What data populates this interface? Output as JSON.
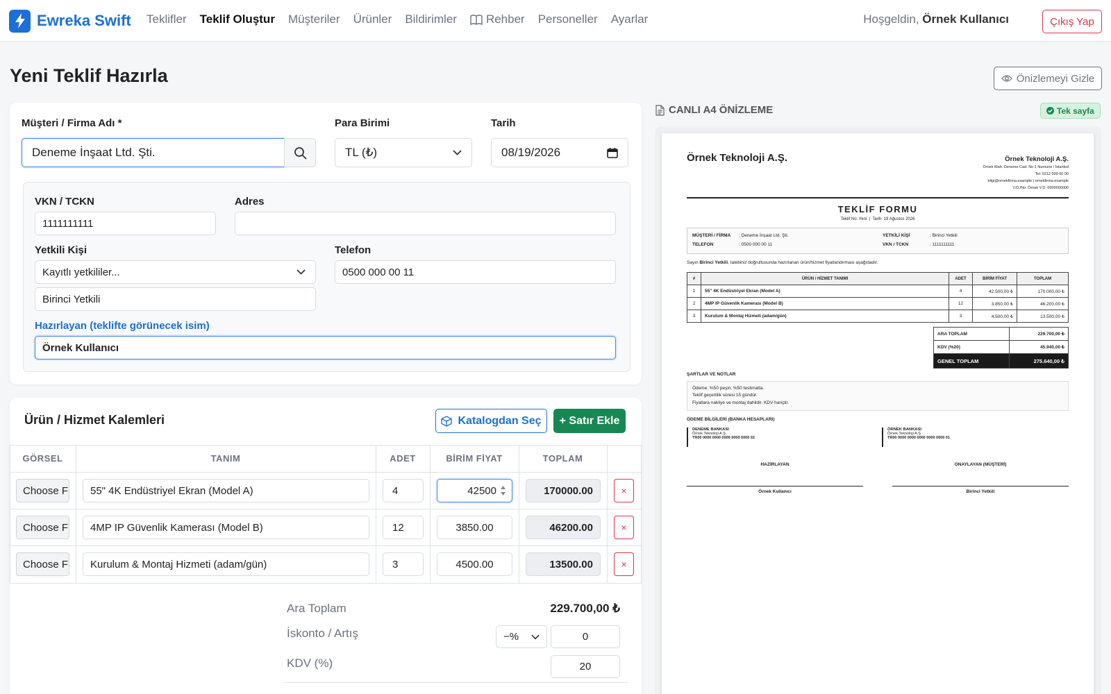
{
  "nav": {
    "brand": "Ewreka Swift",
    "links": [
      "Teklifler",
      "Teklif Oluştur",
      "Müşteriler",
      "Ürünler",
      "Bildirimler",
      "Rehber",
      "Personeller",
      "Ayarlar"
    ],
    "welcome_prefix": "Hoşgeldin,",
    "user": "Örnek Kullanıcı",
    "logout": "Çıkış Yap"
  },
  "page": {
    "title": "Yeni Teklif Hazırla",
    "hide_preview": "Önizlemeyi Gizle"
  },
  "form": {
    "customer_label": "Müşteri / Firma Adı *",
    "customer_value": "Deneme İnşaat Ltd. Şti.",
    "currency_label": "Para Birimi",
    "currency_value": "TL (₺)",
    "date_label": "Tarih",
    "date_value": "08/19/2026",
    "vkn_label": "VKN / TCKN",
    "vkn_value": "1111111111",
    "address_label": "Adres",
    "address_value": "",
    "contact_label": "Yetkili Kişi",
    "contact_select": "Kayıtlı yetkililer...",
    "contact_value": "Birinci Yetkili",
    "phone_label": "Telefon",
    "phone_value": "0500 000 00 11",
    "preparer_label": "Hazırlayan (teklifte görünecek isim)",
    "preparer_value": "Örnek Kullanıcı"
  },
  "items": {
    "title": "Ürün / Hizmet Kalemleri",
    "catalog_button": "Katalogdan Seç",
    "add_row_button": "+ Satır Ekle",
    "headers": [
      "GÖRSEL",
      "TANIM",
      "ADET",
      "BİRİM FİYAT",
      "TOPLAM"
    ],
    "choose_file": "Choose File",
    "rows": [
      {
        "desc": "55\" 4K Endüstriyel Ekran (Model A)",
        "qty": "4",
        "price": "42500",
        "total": "170000.00"
      },
      {
        "desc": "4MP IP Güvenlik Kamerası (Model B)",
        "qty": "12",
        "price": "3850.00",
        "total": "46200.00"
      },
      {
        "desc": "Kurulum & Montaj Hizmeti (adam/gün)",
        "qty": "3",
        "price": "4500.00",
        "total": "13500.00"
      }
    ],
    "delete_glyph": "×"
  },
  "summary": {
    "subtotal_label": "Ara Toplam",
    "subtotal_value": "229.700,00 ₺",
    "discount_label": "İskonto / Artış",
    "discount_type": "−%",
    "discount_value": "0",
    "vat_label": "KDV (%)",
    "vat_value": "20"
  },
  "preview": {
    "header": "CANLI A4 ÖNİZLEME",
    "badge": "Tek sayfa",
    "company": "Örnek Teknoloji A.Ş.",
    "company_right": "Örnek Teknoloji A.Ş.",
    "company_address": "Örnek Mah. Deneme Cad. No:1 Numune / İstanbul",
    "company_phone": "Tel: 0212 000 00 00",
    "company_web": "bilgi@ornekfirma.example | ornekfirma.example",
    "company_tax": "V.D./No: Örnek V.D. 0000000000",
    "form_title": "TEKLİF FORMU",
    "form_sub": "Teklif No: Yeni  |  Tarih: 19 Ağustos 2026",
    "info": {
      "customer_label": "MÜŞTERİ / FİRMA",
      "customer": ": Deneme İnşaat Ltd. Şti.",
      "phone_label": "TELEFON",
      "phone": ": 0500 000 00 11",
      "contact_label": "YETKİLİ KİŞİ",
      "contact": ": Birinci Yetkili",
      "vkn_label": "VKN / TCKN",
      "vkn": ": 1111111111"
    },
    "intro_prefix": "Sayın",
    "intro_name": "Birinci Yetkili",
    "intro_rest": ", talebiniz doğrultusunda hazırlanan ürün/hizmet fiyatlandırması aşağıdadır.",
    "table_headers": [
      "#",
      "ÜRÜN / HİZMET TANIMI",
      "ADET",
      "BİRİM FİYAT",
      "TOPLAM"
    ],
    "rows": [
      {
        "no": "1",
        "desc": "55\" 4K Endüstriyel Ekran (Model A)",
        "qty": "4",
        "price": "42.500,00 ₺",
        "total": "170.000,00 ₺"
      },
      {
        "no": "2",
        "desc": "4MP IP Güvenlik Kamerası (Model B)",
        "qty": "12",
        "price": "3.850,00 ₺",
        "total": "46.200,00 ₺"
      },
      {
        "no": "3",
        "desc": "Kurulum & Montaj Hizmeti (adam/gün)",
        "qty": "3",
        "price": "4.500,00 ₺",
        "total": "13.500,00 ₺"
      }
    ],
    "totals": {
      "sub_label": "ARA TOPLAM",
      "sub": "229.700,00 ₺",
      "vat_label": "KDV (%20)",
      "vat": "45.940,00 ₺",
      "grand_label": "GENEL TOPLAM",
      "grand": "275.640,00 ₺"
    },
    "terms_title": "ŞARTLAR VE NOTLAR",
    "terms": [
      "Ödeme: %50 peşin, %50 teslimatta.",
      "Teklif geçerlilik süresi 15 gündür.",
      "Fiyatlara nakliye ve montaj dahildir. KDV hariçtir."
    ],
    "bank_title": "ÖDEME BİLGİLERİ (BANKA HESAPLARI)",
    "banks": [
      {
        "name": "DENEME BANKASI",
        "holder": "Örnek Teknoloji A.Ş.",
        "iban": "TR00 0000 0000 0000 0000 0000 02"
      },
      {
        "name": "ÖRNEK BANKASI",
        "holder": "Örnek Teknoloji A.Ş.",
        "iban": "TR00 0000 0000 0000 0000 0000 01"
      }
    ],
    "sign_left_title": "HAZIRLAYAN",
    "sign_left_name": "Örnek Kullanıcı",
    "sign_right_title": "ONAYLAYAN (MÜŞTERİ)",
    "sign_right_name": "Birinci Yetkili"
  },
  "colors": {
    "brand": "#1b6fd6",
    "success": "#198754",
    "danger": "#dc3545"
  }
}
